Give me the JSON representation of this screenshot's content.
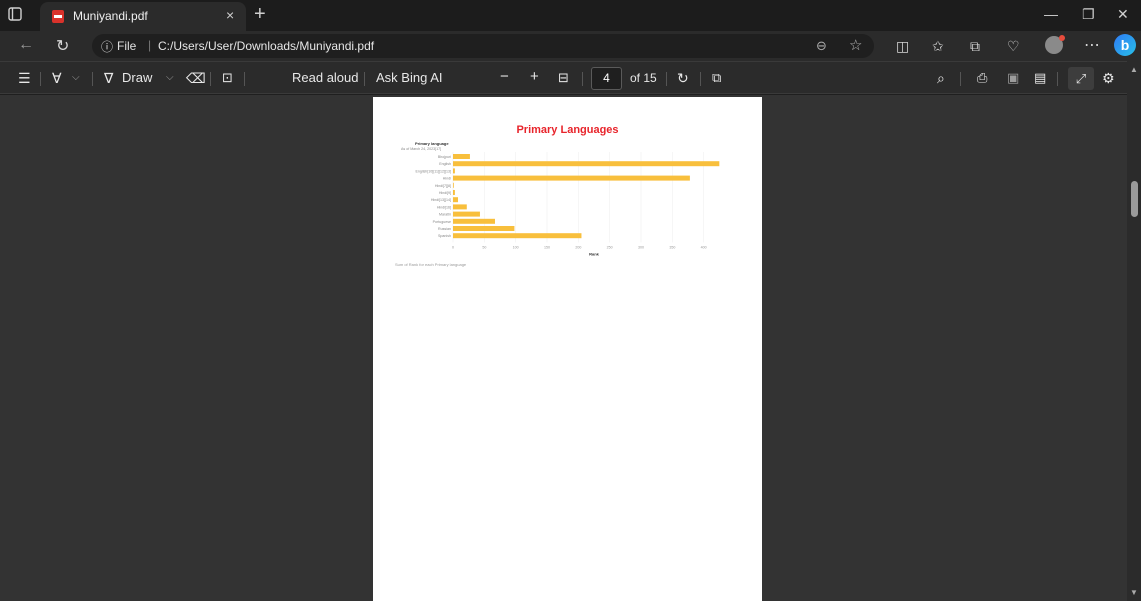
{
  "tab": {
    "title": "Muniyandi.pdf",
    "close": "×",
    "new": "+"
  },
  "window": {
    "minimize": "—",
    "restore": "❐",
    "close": "✕"
  },
  "address": {
    "info_icon": "ⓘ",
    "file_label": "File",
    "separator": "|",
    "url": "C:/Users/User/Downloads/Muniyandi.pdf"
  },
  "pdf_toolbar": {
    "draw_label": "Draw",
    "read_aloud": "Read aloud",
    "ask_bing": "Ask Bing AI",
    "zoom_out": "−",
    "zoom_in": "+",
    "page_current": "4",
    "page_total": "of 15"
  },
  "document": {
    "chart_caption": "Sum of Rank for each Primary language"
  },
  "chart_data": {
    "type": "bar",
    "title": "Primary Languages",
    "ylabel": "Primary language",
    "subtitle": "As of March 24, 2023[17]",
    "xlabel": "Rank",
    "categories": [
      "Bhojpuri",
      "English",
      "English[10][11][12][13]",
      "Hindi",
      "Hindi[7][8]",
      "Hindi[9]",
      "Hindi[13][14]",
      "Hindi[16]",
      "Marathi",
      "Portuguese",
      "Russian",
      "Spanish"
    ],
    "values": [
      27,
      425,
      3,
      378,
      1,
      3,
      8,
      22,
      43,
      67,
      98,
      205
    ],
    "xlim": [
      0,
      450
    ],
    "xticks": [
      0,
      50,
      100,
      150,
      200,
      250,
      300,
      350,
      400
    ],
    "bar_color": "#f8bf3c",
    "grid": true
  }
}
